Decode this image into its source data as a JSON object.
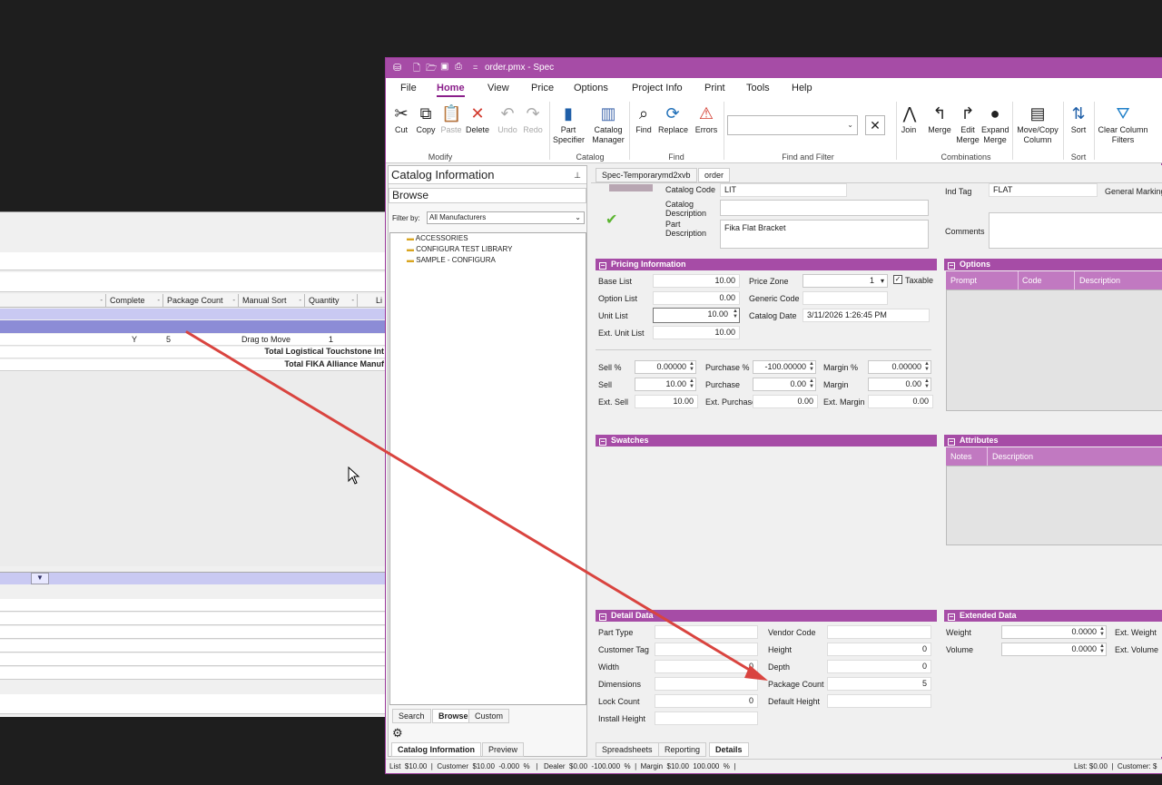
{
  "background_window": {
    "headers": [
      "Complete",
      "Package Count",
      "Manual Sort",
      "Quantity",
      "Li"
    ],
    "row": {
      "complete": "Y",
      "package_count": "5",
      "manual_sort": "Drag to Move",
      "quantity": "1"
    },
    "totals": [
      "Total Logistical Touchstone Int",
      "Total FIKA Alliance Manuf"
    ]
  },
  "window": {
    "title": "order.pmx - Spec",
    "menus": [
      "File",
      "Home",
      "View",
      "Price",
      "Options",
      "Project Info",
      "Print",
      "Tools",
      "Help"
    ],
    "active_menu": "Home"
  },
  "ribbon": {
    "buttons": {
      "cut": "Cut",
      "copy": "Copy",
      "paste": "Paste",
      "delete": "Delete",
      "undo": "Undo",
      "redo": "Redo",
      "part_specifier_1": "Part",
      "part_specifier_2": "Specifier",
      "catalog_manager_1": "Catalog",
      "catalog_manager_2": "Manager",
      "find": "Find",
      "replace": "Replace",
      "errors": "Errors",
      "join": "Join",
      "merge": "Merge",
      "edit_merge_1": "Edit",
      "edit_merge_2": "Merge",
      "expand_merge_1": "Expand",
      "expand_merge_2": "Merge",
      "move_copy_1": "Move/Copy",
      "move_copy_2": "Column",
      "sort": "Sort",
      "clear_filters_1": "Clear Column",
      "clear_filters_2": "Filters"
    },
    "groups": {
      "modify": "Modify",
      "catalog": "Catalog",
      "find": "Find",
      "find_filter": "Find and Filter",
      "combinations": "Combinations",
      "sort": "Sort"
    }
  },
  "catalog_panel": {
    "title": "Catalog Information",
    "browse": "Browse",
    "filter_label": "Filter by:",
    "filter_value": "All Manufacturers",
    "tree": [
      "ACCESSORIES",
      "CONFIGURA TEST LIBRARY",
      "SAMPLE - CONFIGURA"
    ],
    "tabs": [
      "Search",
      "Browse",
      "Custom"
    ],
    "bottom_tabs": [
      "Catalog Information",
      "Preview"
    ]
  },
  "doc_tabs": [
    "Spec-Temporarymd2xvb",
    "order"
  ],
  "header_fields": {
    "catalog_code_label": "Catalog Code",
    "catalog_code": "LIT",
    "catalog_desc_label_1": "Catalog",
    "catalog_desc_label_2": "Description",
    "part_desc_label_1": "Part",
    "part_desc_label_2": "Description",
    "part_desc": "Fika Flat Bracket",
    "ind_tag_label": "Ind Tag",
    "ind_tag": "FLAT",
    "general_marking": "General Marking",
    "comments_label": "Comments"
  },
  "pricing": {
    "title": "Pricing Information",
    "base_list_label": "Base List",
    "base_list": "10.00",
    "option_list_label": "Option List",
    "option_list": "0.00",
    "unit_list_label": "Unit List",
    "unit_list": "10.00",
    "ext_unit_list_label": "Ext. Unit List",
    "ext_unit_list": "10.00",
    "price_zone_label": "Price  Zone",
    "price_zone": "1",
    "taxable_label": "Taxable",
    "generic_code_label": "Generic Code",
    "catalog_date_label": "Catalog Date",
    "catalog_date": "3/11/2026 1:26:45 PM",
    "sell_pct_label": "Sell %",
    "sell_pct": "0.00000",
    "sell_label": "Sell",
    "sell": "10.00",
    "ext_sell_label": "Ext. Sell",
    "ext_sell": "10.00",
    "purchase_pct_label": "Purchase %",
    "purchase_pct": "-100.00000",
    "purchase_label": "Purchase",
    "purchase": "0.00",
    "ext_purchase_label": "Ext. Purchase",
    "ext_purchase": "0.00",
    "margin_pct_label": "Margin %",
    "margin_pct": "0.00000",
    "margin_label": "Margin",
    "margin": "0.00",
    "ext_margin_label": "Ext. Margin",
    "ext_margin": "0.00"
  },
  "options": {
    "title": "Options",
    "columns": [
      "Prompt",
      "Code",
      "Description"
    ]
  },
  "swatches": {
    "title": "Swatches"
  },
  "attributes": {
    "title": "Attributes",
    "columns": [
      "Notes",
      "Description"
    ]
  },
  "detail": {
    "title": "Detail Data",
    "part_type_label": "Part Type",
    "customer_tag_label": "Customer Tag",
    "width_label": "Width",
    "width": "0",
    "dimensions_label": "Dimensions",
    "lock_count_label": "Lock Count",
    "lock_count": "0",
    "install_height_label": "Install Height",
    "vendor_code_label": "Vendor Code",
    "height_label": "Height",
    "height": "0",
    "depth_label": "Depth",
    "depth": "0",
    "package_count_label": "Package Count",
    "package_count": "5",
    "default_height_label": "Default Height"
  },
  "extended": {
    "title": "Extended Data",
    "weight_label": "Weight",
    "weight": "0.0000",
    "volume_label": "Volume",
    "volume": "0.0000",
    "ext_weight_label": "Ext. Weight",
    "ext_volume_label": "Ext. Volume"
  },
  "bottom_tabs": [
    "Spreadsheets",
    "Reporting",
    "Details"
  ],
  "status": {
    "left": "List  $10.00  |  Customer  $10.00  -0.000  %   |   Dealer  $0.00  -100.000  %  |  Margin  $10.00  100.000  %  |",
    "right": "List: $0.00  |  Customer: $"
  },
  "colors": {
    "accent": "#a64ca6",
    "arrow": "#d9443f"
  }
}
